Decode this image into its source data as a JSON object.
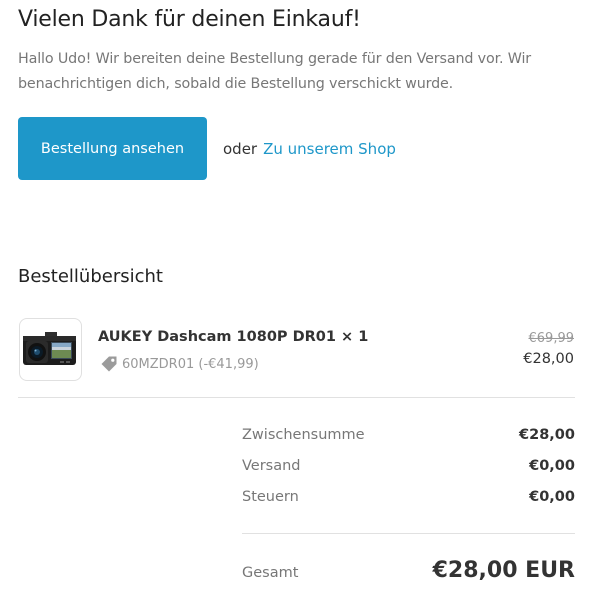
{
  "header": {
    "title": "Vielen Dank für deinen Einkauf!",
    "intro_text": "Hallo Udo! Wir bereiten deine Bestellung gerade für den Versand vor. Wir benachrichtigen dich, sobald die Bestellung verschickt wurde."
  },
  "actions": {
    "view_order_label": "Bestellung ansehen",
    "or_text": "oder",
    "shop_link_label": "Zu unserem Shop",
    "accent_color": "#1e97c9"
  },
  "order_summary": {
    "heading": "Bestellübersicht",
    "items": [
      {
        "name": "AUKEY Dashcam 1080P DR01 × 1",
        "discount_code": "60MZDR01 (-€41,99)",
        "original_price": "€69,99",
        "price": "€28,00",
        "thumbnail_icon": "dashcam-icon",
        "discount_icon": "tag-icon"
      }
    ],
    "subtotal_label": "Zwischensumme",
    "subtotal_value": "€28,00",
    "shipping_label": "Versand",
    "shipping_value": "€0,00",
    "taxes_label": "Steuern",
    "taxes_value": "€0,00",
    "total_label": "Gesamt",
    "total_value": "€28,00 EUR"
  }
}
